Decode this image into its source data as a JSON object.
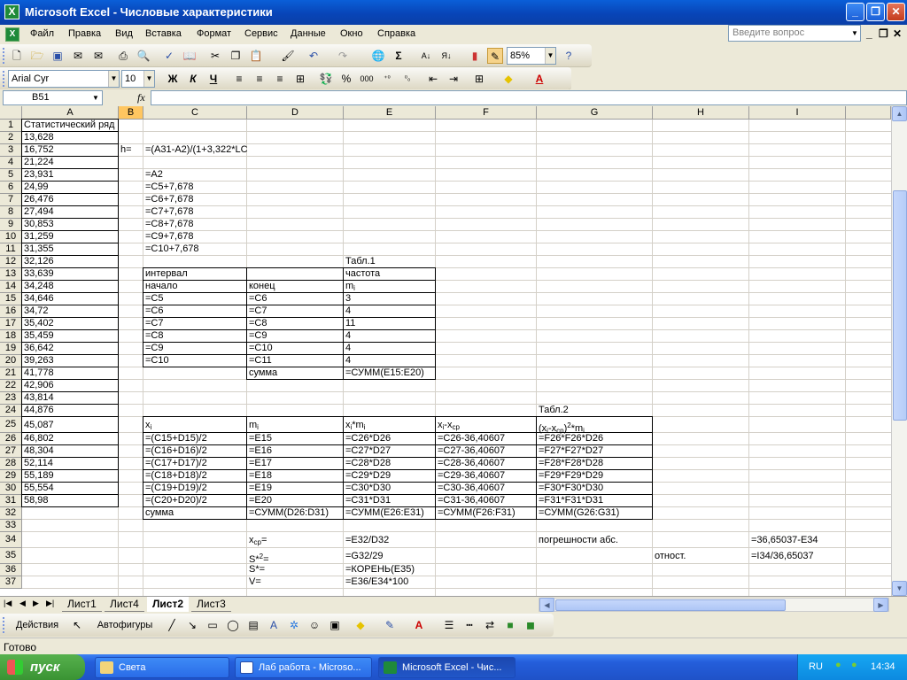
{
  "window": {
    "title": "Microsoft Excel - Числовые характеристики",
    "app_icon": "excel-icon"
  },
  "menu": [
    "Файл",
    "Правка",
    "Вид",
    "Вставка",
    "Формат",
    "Сервис",
    "Данные",
    "Окно",
    "Справка"
  ],
  "help_placeholder": "Введите вопрос",
  "toolbar": {
    "zoom": "85%",
    "font": "Arial Cyr",
    "size": "10",
    "bold": "Ж",
    "italic": "К",
    "underline": "Ч",
    "percent": "%",
    "thousands": "000"
  },
  "formula_bar": {
    "name_box": "B51",
    "fx": "fx",
    "formula": ""
  },
  "columns": [
    "A",
    "B",
    "C",
    "D",
    "E",
    "F",
    "G",
    "H",
    "I"
  ],
  "active_column": "B",
  "rows": [
    "1",
    "2",
    "3",
    "4",
    "5",
    "6",
    "7",
    "8",
    "9",
    "10",
    "11",
    "12",
    "13",
    "14",
    "15",
    "16",
    "17",
    "18",
    "19",
    "20",
    "21",
    "22",
    "23",
    "24",
    "25",
    "26",
    "27",
    "28",
    "29",
    "30",
    "31",
    "32",
    "33",
    "34",
    "35",
    "36",
    "37"
  ],
  "cells": {
    "A1": "Статистический ряд",
    "A2": "13,628",
    "A3": "16,752",
    "A4": "21,224",
    "A5": "23,931",
    "A6": "24,99",
    "A7": "26,476",
    "A8": "27,494",
    "A9": "30,853",
    "A10": "31,259",
    "A11": "31,355",
    "A12": "32,126",
    "A13": "33,639",
    "A14": "34,248",
    "A15": "34,646",
    "A16": "34,72",
    "A17": "35,402",
    "A18": "35,459",
    "A19": "36,642",
    "A20": "39,263",
    "A21": "41,778",
    "A22": "42,906",
    "A23": "43,814",
    "A24": "44,876",
    "A25": "45,087",
    "A26": "46,802",
    "A27": "48,304",
    "A28": "52,114",
    "A29": "55,189",
    "A30": "55,554",
    "A31": "58,98",
    "B3": "h=",
    "C3": "=(A31-A2)/(1+3,322*LC",
    "C5": "=A2",
    "C6": "=C5+7,678",
    "C7": "=C6+7,678",
    "C8": "=C7+7,678",
    "C9": "=C8+7,678",
    "C10": "=C9+7,678",
    "C11": "=C10+7,678",
    "E12": "Табл.1",
    "C13": "интервал",
    "E13": "частота",
    "C14": "начало",
    "D14": "конец",
    "C15": "=C5",
    "D15": "=C6",
    "E15": "3",
    "C16": "=C6",
    "D16": "=C7",
    "E16": "4",
    "C17": "=C7",
    "D17": "=C8",
    "E17": "11",
    "C18": "=C8",
    "D18": "=C9",
    "E18": "4",
    "C19": "=C9",
    "D19": "=C10",
    "E19": "4",
    "C20": "=C10",
    "D20": "=C11",
    "E20": "4",
    "D21": "сумма",
    "E21": "=СУММ(E15:E20)",
    "G24": "Табл.2",
    "C26": "=(C15+D15)/2",
    "D26": "=E15",
    "E26": "=C26*D26",
    "F26": "=C26-36,40607",
    "G26": "=F26*F26*D26",
    "C27": "=(C16+D16)/2",
    "D27": "=E16",
    "E27": "=C27*D27",
    "F27": "=C27-36,40607",
    "G27": "=F27*F27*D27",
    "C28": "=(C17+D17)/2",
    "D28": "=E17",
    "E28": "=C28*D28",
    "F28": "=C28-36,40607",
    "G28": "=F28*F28*D28",
    "C29": "=(C18+D18)/2",
    "D29": "=E18",
    "E29": "=C29*D29",
    "F29": "=C29-36,40607",
    "G29": "=F29*F29*D29",
    "C30": "=(C19+D19)/2",
    "D30": "=E19",
    "E30": "=C30*D30",
    "F30": "=C30-36,40607",
    "G30": "=F30*F30*D30",
    "C31": "=(C20+D20)/2",
    "D31": "=E20",
    "E31": "=C31*D31",
    "F31": "=C31-36,40607",
    "G31": "=F31*F31*D31",
    "C32": "сумма",
    "D32": "=СУММ(D26:D31)",
    "E32": "=СУММ(E26:E31)",
    "F32": "=СУММ(F26:F31)",
    "G32": "=СУММ(G26:G31)",
    "E34": "=E32/D32",
    "G34": "погрешности абс.",
    "I34": "=36,65037-E34",
    "H35": "отност.",
    "I35": "=I34/36,65037",
    "E35": "=G32/29",
    "E36": "=КОРЕНЬ(E35)",
    "E37": "=E36/E34*100"
  },
  "rich_cells": {
    "E14": "m<sub>i</sub>",
    "C25": "x<sub>i</sub>",
    "D25": "m<sub>i</sub>",
    "E25": "x<sub>i</sub>*m<sub>i</sub>",
    "F25": "x<sub>i</sub>-x<sub>ср</sub>",
    "G25": "(x<sub>i</sub>-x<sub>ср</sub>)<sup>2</sup>*m<sub>i</sub>",
    "D34": "x<sub>ср</sub>=",
    "D35": "S*<sup>2</sup>=",
    "D36": "S*=",
    "D37": "V="
  },
  "sheet_tabs": [
    "Лист1",
    "Лист4",
    "Лист2",
    "Лист3"
  ],
  "active_tab": "Лист2",
  "drawing": {
    "actions": "Действия",
    "autoshapes": "Автофигуры"
  },
  "status": "Готово",
  "taskbar": {
    "start": "пуск",
    "tasks": [
      "Света",
      "Лаб работа - Microsо...",
      "Microsoft Excel - Чис..."
    ],
    "lang": "RU",
    "clock": "14:34"
  }
}
